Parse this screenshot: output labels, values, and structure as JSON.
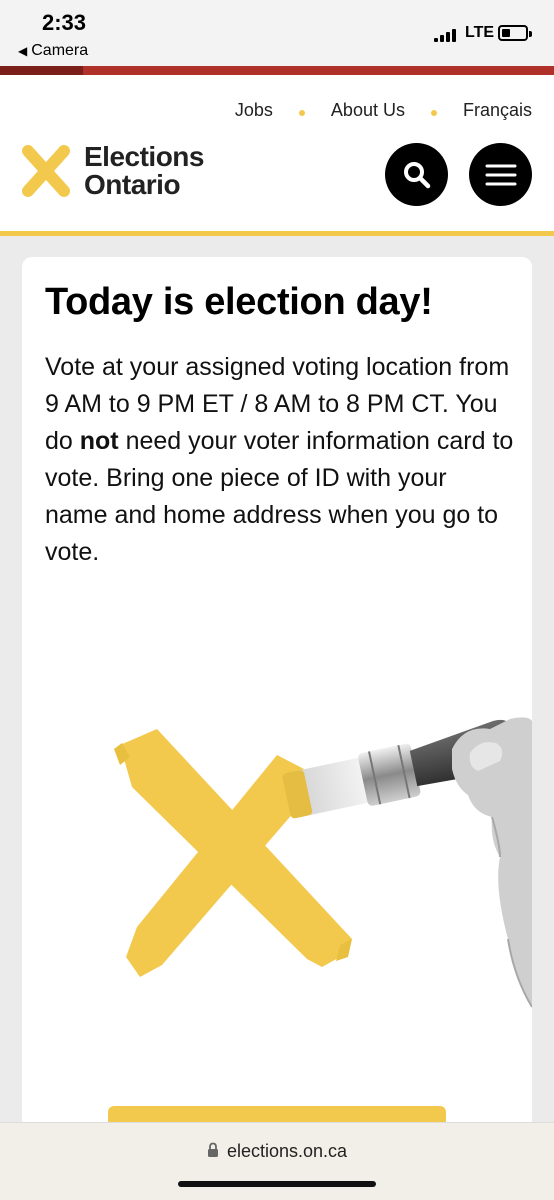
{
  "status_bar": {
    "time": "2:33",
    "back_label": "Camera",
    "network": "LTE",
    "battery_level": 0.35
  },
  "page_load_progress": 0.15,
  "header": {
    "nav": [
      "Jobs",
      "About Us",
      "Français"
    ],
    "logo_line1": "Elections",
    "logo_line2": "Ontario",
    "search_icon": "search-icon",
    "menu_icon": "hamburger-menu-icon",
    "accent_color": "#f2c94c"
  },
  "main": {
    "title": "Today is election day!",
    "body_before_bold": "Vote at your assigned voting location from 9 AM to 9 PM ET / 8 AM to 8 PM CT. You do ",
    "body_bold": "not",
    "body_after_bold": " need your voter information card to vote. Bring one piece of ID with your name and home address when you go to vote."
  },
  "browser": {
    "url": "elections.on.ca",
    "lock_icon": "lock-icon"
  }
}
